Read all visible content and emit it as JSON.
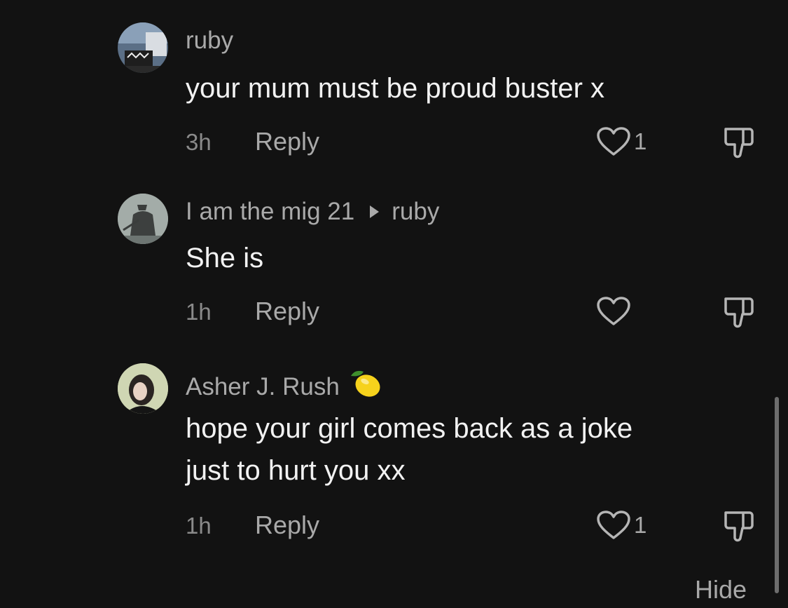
{
  "comments": [
    {
      "username": "ruby",
      "reply_to": "",
      "text_lines": [
        "your mum must be proud buster x"
      ],
      "time": "3h",
      "reply_label": "Reply",
      "like_count": "1"
    },
    {
      "username": "I am the mig 21",
      "reply_to": "ruby",
      "text_lines": [
        "She is"
      ],
      "time": "1h",
      "reply_label": "Reply",
      "like_count": ""
    },
    {
      "username": "Asher J. Rush",
      "reply_to": "",
      "text_lines": [
        "hope your girl comes back as a joke",
        "just to hurt you xx"
      ],
      "time": "1h",
      "reply_label": "Reply",
      "like_count": "1"
    }
  ],
  "hide_label": "Hide",
  "icons": {
    "like": "heart-outline-icon",
    "dislike": "thumbs-down-outline-icon",
    "badge": "lemon-emoji"
  },
  "colors": {
    "background": "#121212",
    "primary_text": "#f2f2f2",
    "secondary_text": "#a9a9a9"
  }
}
